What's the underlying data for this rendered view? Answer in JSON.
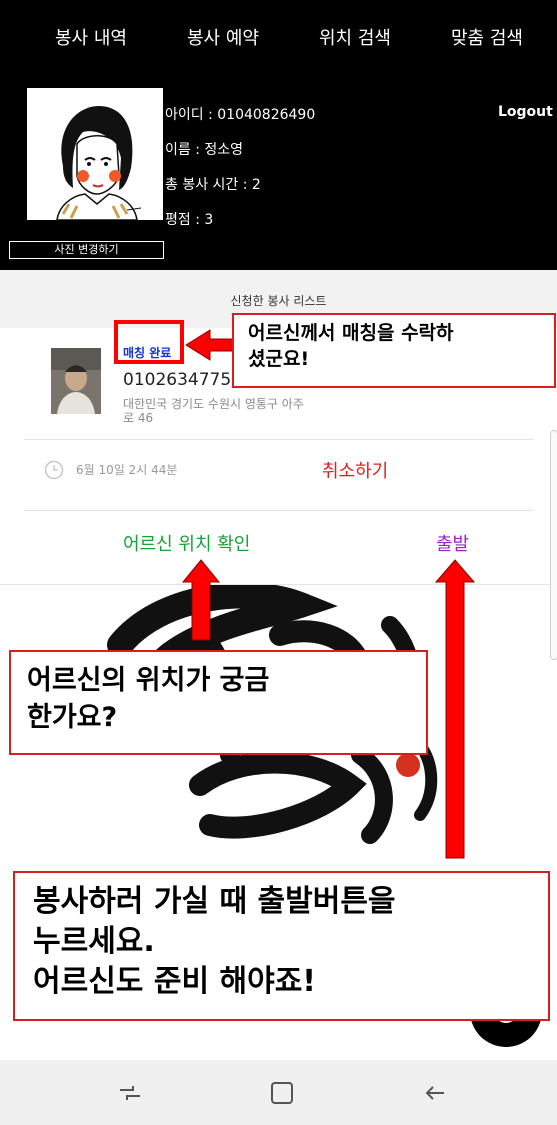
{
  "nav": {
    "items": [
      "봉사 내역",
      "봉사 예약",
      "위치 검색",
      "맞춤 검색"
    ]
  },
  "profile": {
    "id_line": "아이디 : 01040826490",
    "name_line": "이름 : 정소영",
    "hours_line": "총 봉사 시간 : 2",
    "rating_line": "평점 : 3",
    "logout_label": "Logout",
    "photo_change_label": "사진 변경하기"
  },
  "list": {
    "title": "신청한 봉사 리스트",
    "item": {
      "status": "매칭 완료",
      "phone": "0102634775",
      "address": "대한민국 경기도 수원시 영통구 아주로 46",
      "datetime": "6월 10일 2시 44분",
      "cancel_label": "취소하기",
      "elder_location_label": "어르신 위치 확인",
      "depart_label": "출발"
    }
  },
  "callouts": {
    "matched": [
      "어르신께서 매칭을 수락하",
      "셨군요!"
    ],
    "location": [
      "어르신의 위치가 궁금",
      "한가요?"
    ],
    "depart": [
      "봉사하러 가실 때 출발버튼을",
      "누르세요.",
      "어르신도 준비 해야죠!"
    ]
  },
  "icons": {
    "clock": "clock-icon",
    "recent": "recent-apps-icon",
    "home": "home-icon",
    "back": "back-icon"
  },
  "colors": {
    "header_bg": "#000000",
    "status_blue": "#1530d8",
    "cancel_red": "#e02020",
    "location_green": "#16a335",
    "depart_purple": "#9a22c4",
    "annotation_red": "#ff0000"
  }
}
